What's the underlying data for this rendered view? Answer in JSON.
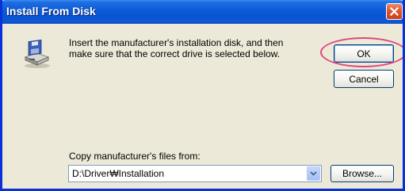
{
  "window": {
    "title": "Install From Disk",
    "close_icon": "close-icon"
  },
  "message": {
    "line1": "Insert the manufacturer's installation disk, and then",
    "line2": "make sure that the correct drive is selected below."
  },
  "buttons": {
    "ok": "OK",
    "cancel": "Cancel",
    "browse": "Browse..."
  },
  "copy": {
    "label": "Copy manufacturer's files from:",
    "value": "D:\\Driver₩Installation"
  },
  "icons": {
    "disk": "floppy-disk-drive-icon",
    "dropdown": "chevron-down-icon"
  },
  "colors": {
    "titlebar": "#0a5bd8",
    "highlight": "#e0457e",
    "dialog_bg": "#ece9d8"
  }
}
